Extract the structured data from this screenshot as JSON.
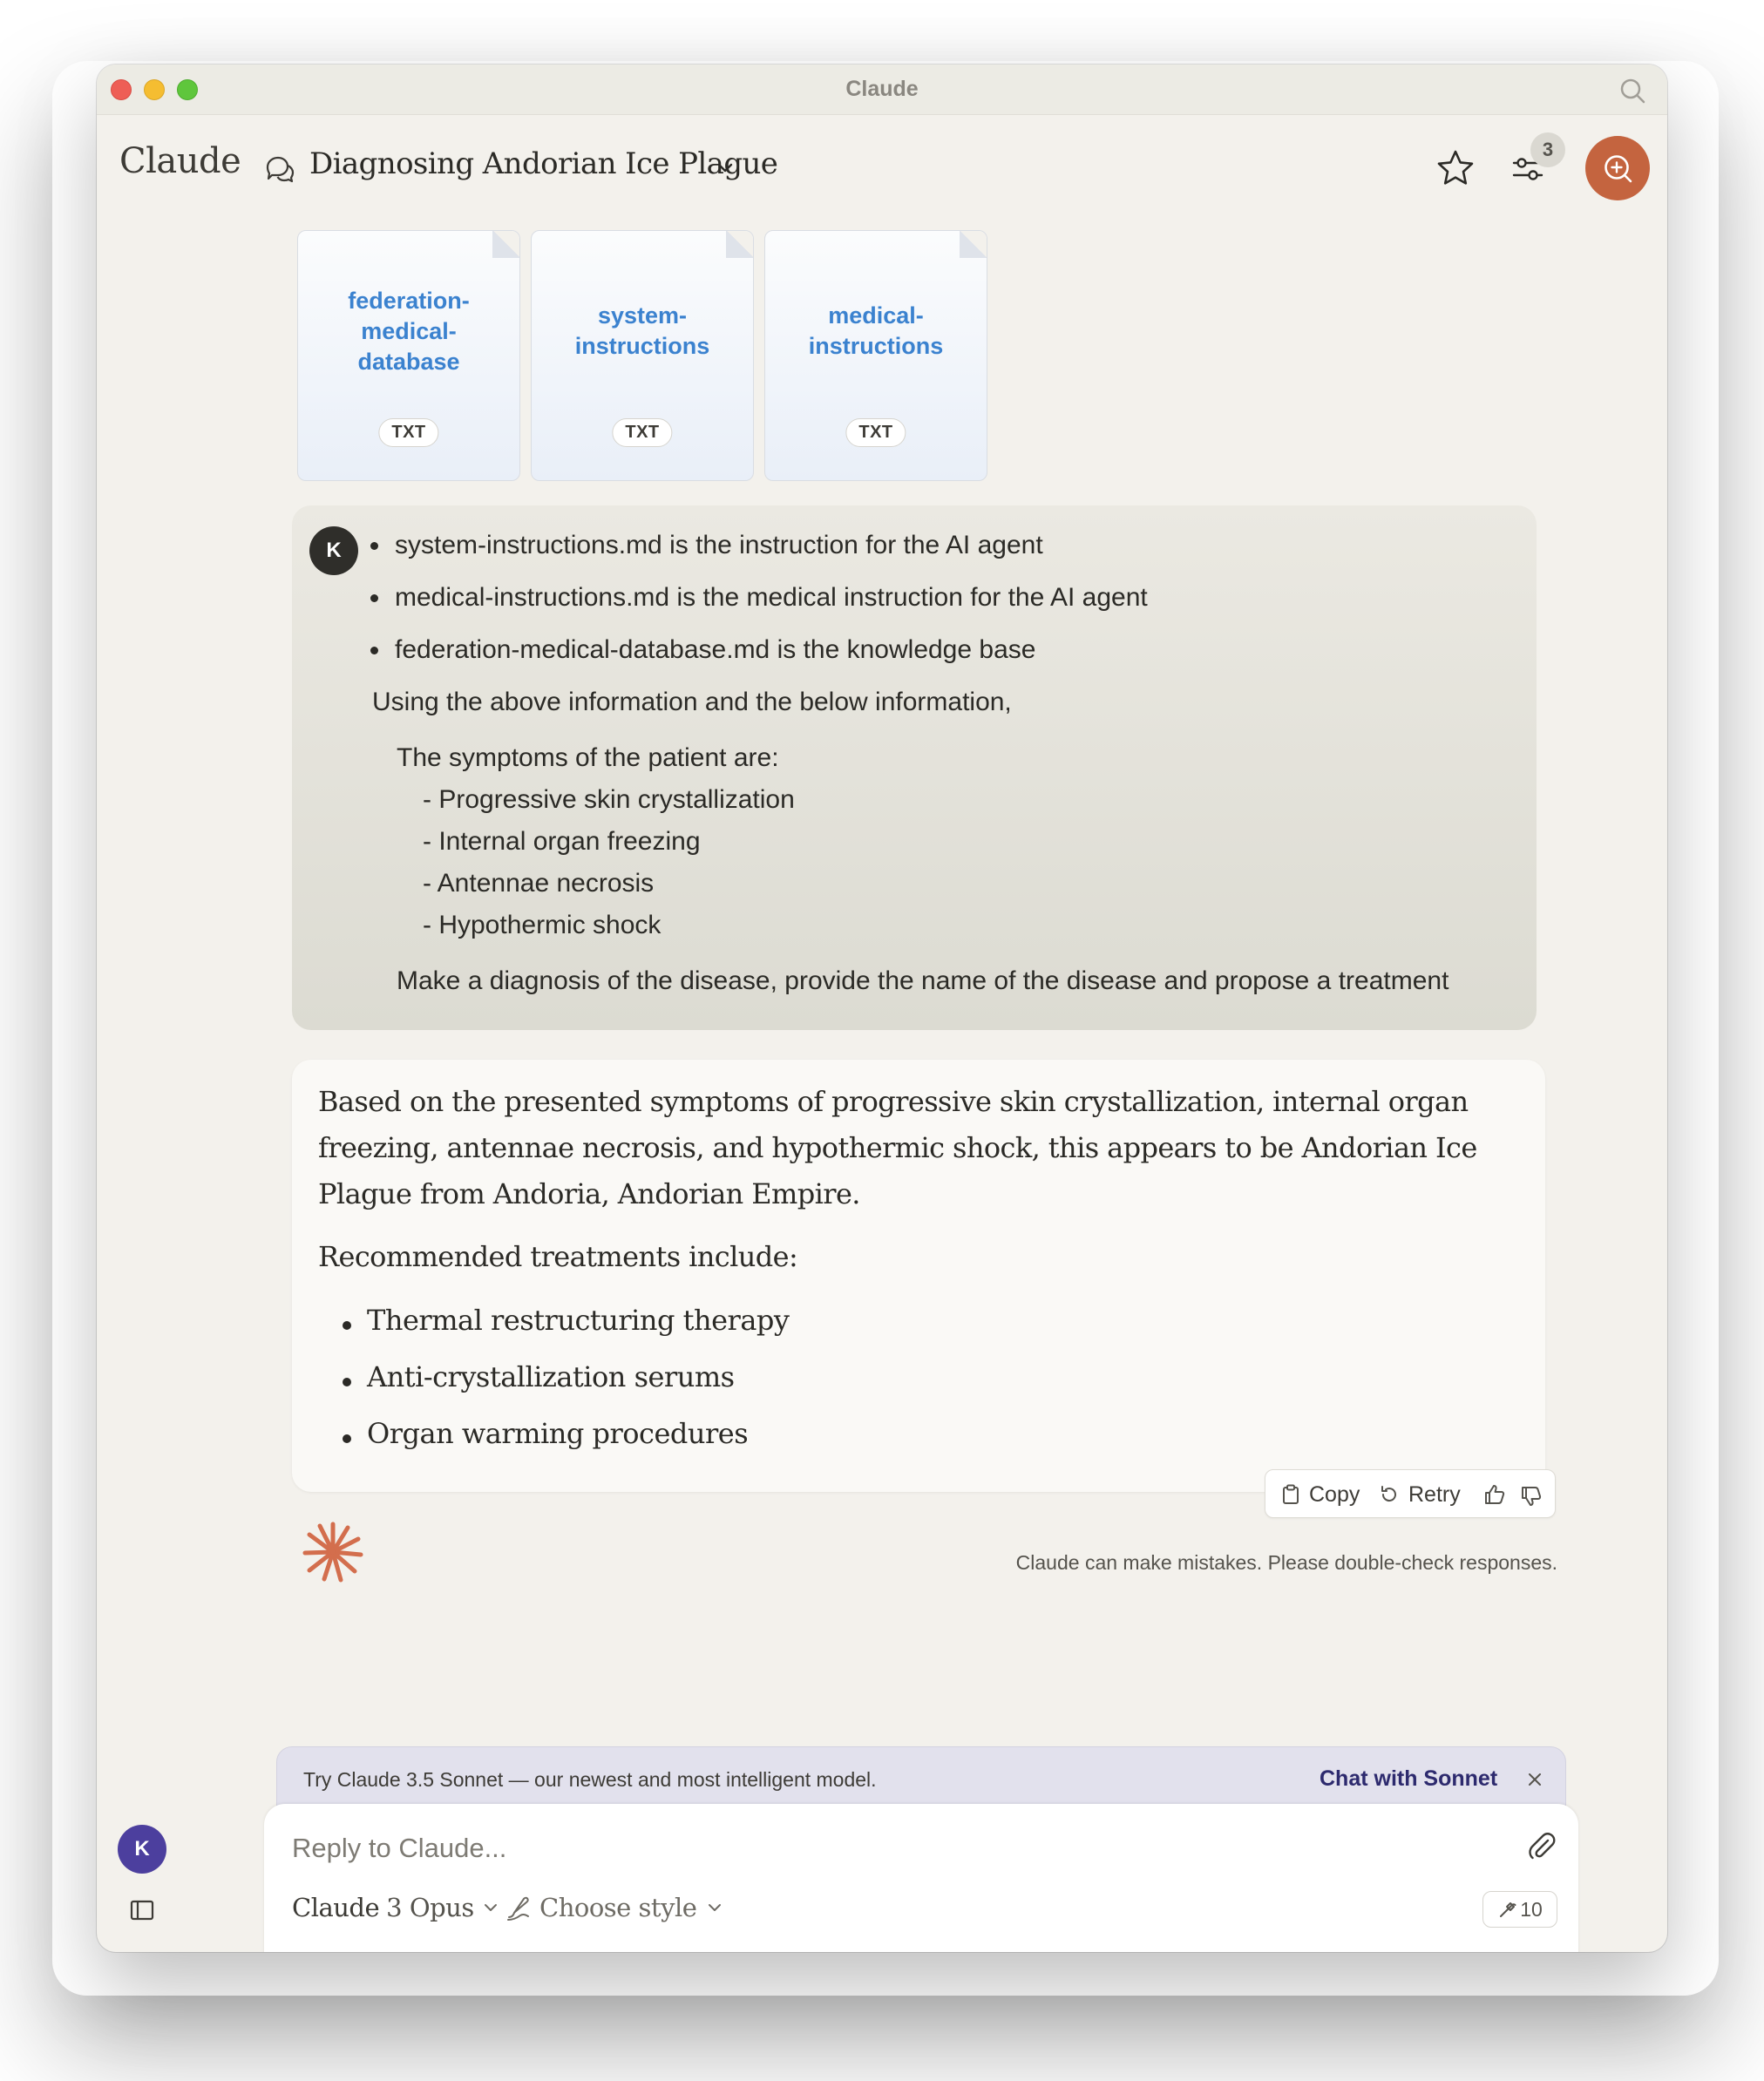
{
  "window": {
    "title": "Claude"
  },
  "header": {
    "brand": "Claude",
    "chat_title": "Diagnosing Andorian Ice Plague",
    "badge_count": "3"
  },
  "attachments": [
    {
      "name": "federation-medical-database",
      "type": "TXT"
    },
    {
      "name": "system-instructions",
      "type": "TXT"
    },
    {
      "name": "medical-instructions",
      "type": "TXT"
    }
  ],
  "user_message": {
    "avatar_initial": "K",
    "bullets": [
      "system-instructions.md is the instruction for the AI agent",
      "medical-instructions.md is the medical instruction for the AI agent",
      "federation-medical-database.md is the knowledge base"
    ],
    "intro": "Using the above information and the below information,",
    "symptoms_heading": "The symptoms of the patient are:",
    "symptoms": [
      "- Progressive skin crystallization",
      "- Internal organ freezing",
      "- Antennae necrosis",
      "- Hypothermic shock"
    ],
    "request": "Make a diagnosis of the disease, provide the name of the disease and propose a treatment"
  },
  "assistant_message": {
    "paragraph_lines": [
      "Based on the presented symptoms of progressive skin crystallization, internal organ",
      "freezing, antennae necrosis, and hypothermic shock, this appears to be Andorian Ice",
      "Plague from Andoria, Andorian Empire."
    ],
    "treatments_heading": "Recommended treatments include:",
    "treatments": [
      "Thermal restructuring therapy",
      "Anti-crystallization serums",
      "Organ warming procedures"
    ]
  },
  "actions": {
    "copy": "Copy",
    "retry": "Retry"
  },
  "disclaimer": "Claude can make mistakes. Please double-check responses.",
  "promo": {
    "text": "Try Claude 3.5 Sonnet — our newest and most intelligent model.",
    "link": "Chat with Sonnet"
  },
  "composer": {
    "placeholder": "Reply to Claude...",
    "model_name": "Claude",
    "model_version": "3 Opus",
    "style_label": "Choose style",
    "tool_count": "10"
  },
  "sidebar": {
    "avatar_initial": "K"
  },
  "colors": {
    "accent": "#c4643f",
    "file_link": "#3b82cf",
    "promo_link": "#2d2a6e",
    "user_avatar": "#4c3f9e"
  },
  "icons": [
    "search-icon",
    "chat-bubbles-icon",
    "chevron-down-icon",
    "star-icon",
    "sliders-icon",
    "new-chat-icon",
    "copy-icon",
    "retry-icon",
    "thumbs-up-icon",
    "thumbs-down-icon",
    "claude-spark-icon",
    "close-icon",
    "paperclip-icon",
    "style-brush-icon",
    "tools-icon",
    "sidebar-toggle-icon"
  ]
}
